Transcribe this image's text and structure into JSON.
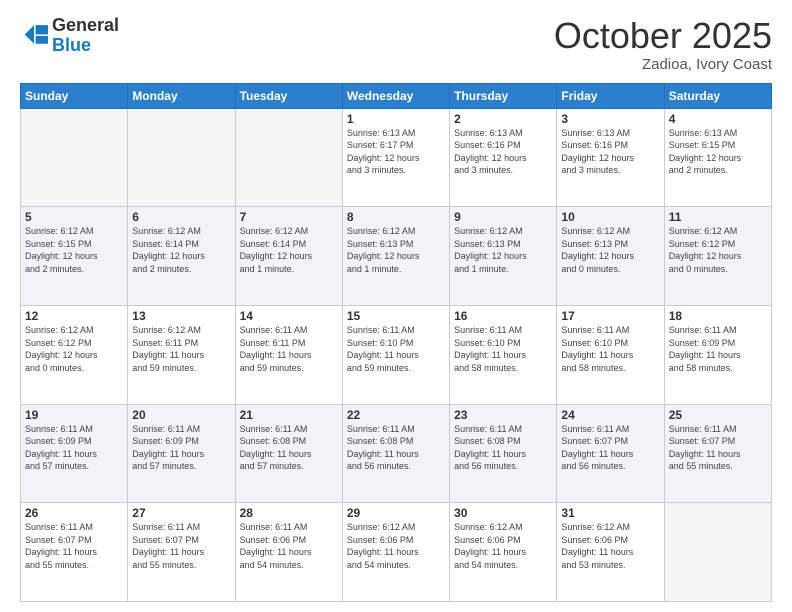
{
  "header": {
    "logo_general": "General",
    "logo_blue": "Blue",
    "month": "October 2025",
    "location": "Zadioa, Ivory Coast"
  },
  "weekdays": [
    "Sunday",
    "Monday",
    "Tuesday",
    "Wednesday",
    "Thursday",
    "Friday",
    "Saturday"
  ],
  "weeks": [
    [
      {
        "day": "",
        "info": ""
      },
      {
        "day": "",
        "info": ""
      },
      {
        "day": "",
        "info": ""
      },
      {
        "day": "1",
        "info": "Sunrise: 6:13 AM\nSunset: 6:17 PM\nDaylight: 12 hours\nand 3 minutes."
      },
      {
        "day": "2",
        "info": "Sunrise: 6:13 AM\nSunset: 6:16 PM\nDaylight: 12 hours\nand 3 minutes."
      },
      {
        "day": "3",
        "info": "Sunrise: 6:13 AM\nSunset: 6:16 PM\nDaylight: 12 hours\nand 3 minutes."
      },
      {
        "day": "4",
        "info": "Sunrise: 6:13 AM\nSunset: 6:15 PM\nDaylight: 12 hours\nand 2 minutes."
      }
    ],
    [
      {
        "day": "5",
        "info": "Sunrise: 6:12 AM\nSunset: 6:15 PM\nDaylight: 12 hours\nand 2 minutes."
      },
      {
        "day": "6",
        "info": "Sunrise: 6:12 AM\nSunset: 6:14 PM\nDaylight: 12 hours\nand 2 minutes."
      },
      {
        "day": "7",
        "info": "Sunrise: 6:12 AM\nSunset: 6:14 PM\nDaylight: 12 hours\nand 1 minute."
      },
      {
        "day": "8",
        "info": "Sunrise: 6:12 AM\nSunset: 6:13 PM\nDaylight: 12 hours\nand 1 minute."
      },
      {
        "day": "9",
        "info": "Sunrise: 6:12 AM\nSunset: 6:13 PM\nDaylight: 12 hours\nand 1 minute."
      },
      {
        "day": "10",
        "info": "Sunrise: 6:12 AM\nSunset: 6:13 PM\nDaylight: 12 hours\nand 0 minutes."
      },
      {
        "day": "11",
        "info": "Sunrise: 6:12 AM\nSunset: 6:12 PM\nDaylight: 12 hours\nand 0 minutes."
      }
    ],
    [
      {
        "day": "12",
        "info": "Sunrise: 6:12 AM\nSunset: 6:12 PM\nDaylight: 12 hours\nand 0 minutes."
      },
      {
        "day": "13",
        "info": "Sunrise: 6:12 AM\nSunset: 6:11 PM\nDaylight: 11 hours\nand 59 minutes."
      },
      {
        "day": "14",
        "info": "Sunrise: 6:11 AM\nSunset: 6:11 PM\nDaylight: 11 hours\nand 59 minutes."
      },
      {
        "day": "15",
        "info": "Sunrise: 6:11 AM\nSunset: 6:10 PM\nDaylight: 11 hours\nand 59 minutes."
      },
      {
        "day": "16",
        "info": "Sunrise: 6:11 AM\nSunset: 6:10 PM\nDaylight: 11 hours\nand 58 minutes."
      },
      {
        "day": "17",
        "info": "Sunrise: 6:11 AM\nSunset: 6:10 PM\nDaylight: 11 hours\nand 58 minutes."
      },
      {
        "day": "18",
        "info": "Sunrise: 6:11 AM\nSunset: 6:09 PM\nDaylight: 11 hours\nand 58 minutes."
      }
    ],
    [
      {
        "day": "19",
        "info": "Sunrise: 6:11 AM\nSunset: 6:09 PM\nDaylight: 11 hours\nand 57 minutes."
      },
      {
        "day": "20",
        "info": "Sunrise: 6:11 AM\nSunset: 6:09 PM\nDaylight: 11 hours\nand 57 minutes."
      },
      {
        "day": "21",
        "info": "Sunrise: 6:11 AM\nSunset: 6:08 PM\nDaylight: 11 hours\nand 57 minutes."
      },
      {
        "day": "22",
        "info": "Sunrise: 6:11 AM\nSunset: 6:08 PM\nDaylight: 11 hours\nand 56 minutes."
      },
      {
        "day": "23",
        "info": "Sunrise: 6:11 AM\nSunset: 6:08 PM\nDaylight: 11 hours\nand 56 minutes."
      },
      {
        "day": "24",
        "info": "Sunrise: 6:11 AM\nSunset: 6:07 PM\nDaylight: 11 hours\nand 56 minutes."
      },
      {
        "day": "25",
        "info": "Sunrise: 6:11 AM\nSunset: 6:07 PM\nDaylight: 11 hours\nand 55 minutes."
      }
    ],
    [
      {
        "day": "26",
        "info": "Sunrise: 6:11 AM\nSunset: 6:07 PM\nDaylight: 11 hours\nand 55 minutes."
      },
      {
        "day": "27",
        "info": "Sunrise: 6:11 AM\nSunset: 6:07 PM\nDaylight: 11 hours\nand 55 minutes."
      },
      {
        "day": "28",
        "info": "Sunrise: 6:11 AM\nSunset: 6:06 PM\nDaylight: 11 hours\nand 54 minutes."
      },
      {
        "day": "29",
        "info": "Sunrise: 6:12 AM\nSunset: 6:06 PM\nDaylight: 11 hours\nand 54 minutes."
      },
      {
        "day": "30",
        "info": "Sunrise: 6:12 AM\nSunset: 6:06 PM\nDaylight: 11 hours\nand 54 minutes."
      },
      {
        "day": "31",
        "info": "Sunrise: 6:12 AM\nSunset: 6:06 PM\nDaylight: 11 hours\nand 53 minutes."
      },
      {
        "day": "",
        "info": ""
      }
    ]
  ]
}
